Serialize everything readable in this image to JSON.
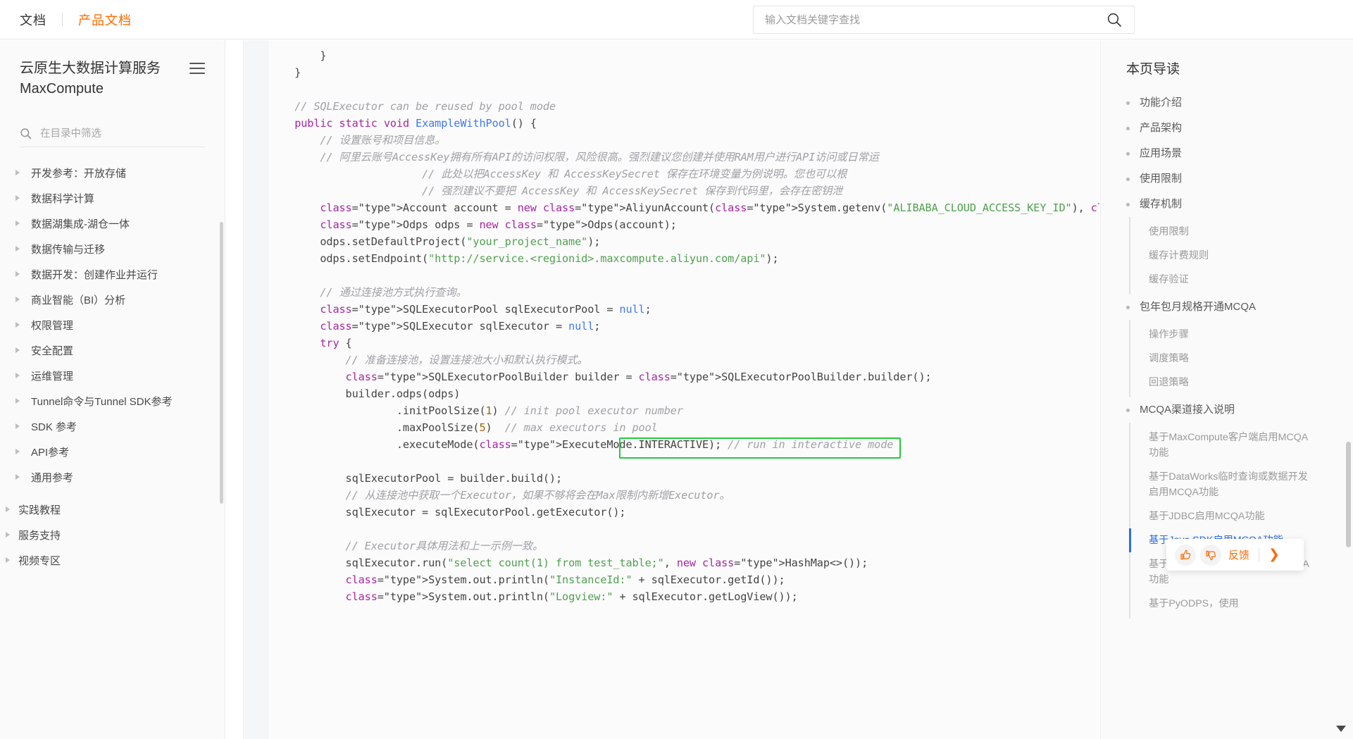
{
  "topbar": {
    "doc_label": "文档",
    "product_label": "产品文档",
    "search_placeholder": "输入文档关键字查找",
    "search_value": "",
    "search_icon": "search-icon"
  },
  "sidebar": {
    "title": "云原生大数据计算服务 MaxCompute",
    "menu_icon": "hamburger-icon",
    "filter_placeholder": "在目录中筛选",
    "filter_value": "",
    "filter_icon": "search-icon",
    "items": [
      {
        "label": "开发参考：开放存储",
        "level": 1
      },
      {
        "label": "数据科学计算",
        "level": 1
      },
      {
        "label": "数据湖集成-湖仓一体",
        "level": 1
      },
      {
        "label": "数据传输与迁移",
        "level": 1
      },
      {
        "label": "数据开发：创建作业并运行",
        "level": 1
      },
      {
        "label": "商业智能（BI）分析",
        "level": 1
      },
      {
        "label": "权限管理",
        "level": 1
      },
      {
        "label": "安全配置",
        "level": 1
      },
      {
        "label": "运维管理",
        "level": 1
      },
      {
        "label": "Tunnel命令与Tunnel SDK参考",
        "level": 1
      },
      {
        "label": "SDK 参考",
        "level": 1
      },
      {
        "label": "API参考",
        "level": 1
      },
      {
        "label": "通用参考",
        "level": 1
      },
      {
        "label": "实践教程",
        "level": 0
      },
      {
        "label": "服务支持",
        "level": 0
      },
      {
        "label": "视频专区",
        "level": 0
      }
    ]
  },
  "toc": {
    "title": "本页导读",
    "items": [
      {
        "label": "功能介绍",
        "level": 1
      },
      {
        "label": "产品架构",
        "level": 1
      },
      {
        "label": "应用场景",
        "level": 1
      },
      {
        "label": "使用限制",
        "level": 1
      },
      {
        "label": "缓存机制",
        "level": 1,
        "children": [
          {
            "label": "使用限制",
            "active": false
          },
          {
            "label": "缓存计费规则",
            "active": false
          },
          {
            "label": "缓存验证",
            "active": false
          }
        ]
      },
      {
        "label": "包年包月规格开通MCQA",
        "level": 1,
        "children": [
          {
            "label": "操作步骤",
            "active": false
          },
          {
            "label": "调度策略",
            "active": false
          },
          {
            "label": "回退策略",
            "active": false
          }
        ]
      },
      {
        "label": "MCQA渠道接入说明",
        "level": 1,
        "children": [
          {
            "label": "基于MaxCompute客户端启用MCQA功能",
            "active": false
          },
          {
            "label": "基于DataWorks临时查询或数据开发启用MCQA功能",
            "active": false
          },
          {
            "label": "基于JDBC启用MCQA功能",
            "active": false
          },
          {
            "label": "基于Java SDK启用MCQA功能",
            "active": true
          },
          {
            "label": "基于MaxCompute Studio启用MCQA功能",
            "active": false
          },
          {
            "label": "基于PyODPS，使用",
            "active": false
          }
        ]
      }
    ]
  },
  "feedback": {
    "thumbs_up_icon": "thumbs-up-icon",
    "thumbs_down_icon": "thumbs-down-icon",
    "label": "反馈",
    "chevron_icon": "chevron-right-icon"
  },
  "content": {
    "highlight_color": "#27c840",
    "highlighted_line": ".maxPoolSize(5)  // max executors in pool",
    "code_lines": [
      "        }",
      "    }",
      "",
      "    // SQLExecutor can be reused by pool mode",
      "    public static void ExampleWithPool() {",
      "        // 设置账号和项目信息。",
      "        // 阿里云账号AccessKey拥有所有API的访问权限，风险很高。强烈建议您创建并使用RAM用户进行API访问或日常运",
      "                        // 此处以把AccessKey 和 AccessKeySecret 保存在环境变量为例说明。您也可以根",
      "                        // 强烈建议不要把 AccessKey 和 AccessKeySecret 保存到代码里，会存在密钥泄",
      "        Account account = new AliyunAccount(System.getenv(\"ALIBABA_CLOUD_ACCESS_KEY_ID\"), System.get",
      "        Odps odps = new Odps(account);",
      "        odps.setDefaultProject(\"your_project_name\");",
      "        odps.setEndpoint(\"http://service.<regionid>.maxcompute.aliyun.com/api\");",
      "",
      "        // 通过连接池方式执行查询。",
      "        SQLExecutorPool sqlExecutorPool = null;",
      "        SQLExecutor sqlExecutor = null;",
      "        try {",
      "            // 准备连接池，设置连接池大小和默认执行模式。",
      "            SQLExecutorPoolBuilder builder = SQLExecutorPoolBuilder.builder();",
      "            builder.odps(odps)",
      "                    .initPoolSize(1) // init pool executor number",
      "                    .maxPoolSize(5)  // max executors in pool",
      "                    .executeMode(ExecuteMode.INTERACTIVE); // run in interactive mode",
      "",
      "            sqlExecutorPool = builder.build();",
      "            // 从连接池中获取一个Executor，如果不够将会在Max限制内新增Executor。",
      "            sqlExecutor = sqlExecutorPool.getExecutor();",
      "",
      "            // Executor具体用法和上一示例一致。",
      "            sqlExecutor.run(\"select count(1) from test_table;\", new HashMap<>());",
      "            System.out.println(\"InstanceId:\" + sqlExecutor.getId());",
      "            System.out.println(\"Logview:\" + sqlExecutor.getLogView());"
    ]
  }
}
